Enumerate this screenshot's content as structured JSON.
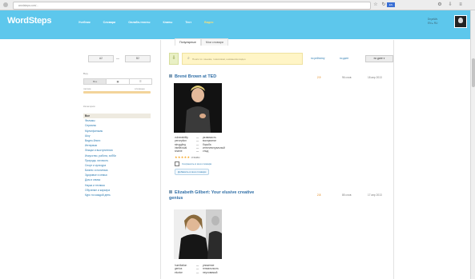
{
  "browser": {
    "url": "wordsteps.com/...",
    "badge": "EN"
  },
  "site": {
    "logo": "WordSteps",
    "nav": [
      "Учебник",
      "Словари",
      "Онлайн-тексты",
      "Клипы",
      "Тест",
      "Видео"
    ],
    "user_line1": "DnyaWs",
    "user_line2": "EN ▸ RU"
  },
  "tabs": [
    "Популярные",
    "Мои словари"
  ],
  "sidebar": {
    "level_from": "A2",
    "level_to": "B2",
    "level_dash": "—",
    "view_label": "Вид",
    "view_options": [
      "Все",
      "▦",
      "☰"
    ],
    "range_min": "легкие",
    "range_max": "сложные",
    "categories_label": "Категории",
    "categories": [
      "Все",
      "Фильмы",
      "Сериалы",
      "Мультфильмы",
      "Шоу",
      "Видео-блоги",
      "Интервью",
      "Лекции и выступления",
      "Искусство, работа, хобби",
      "Природа, личность",
      "Спорт и культура",
      "Бизнес и политика",
      "Здоровье и семья",
      "Дом и семья",
      "Наука и техника",
      "Обучение и карьера",
      "Курс по каждой день"
    ]
  },
  "search": {
    "placeholder": "Поиск по: языкам, тематикам, названиям видео",
    "sort_popularity": "по рейтингу",
    "sort_date": "по дате",
    "sort_button": "по дате ▾"
  },
  "videos": [
    {
      "title": "Brené Brown at TED",
      "level": "2.9",
      "words": "96 слов",
      "date": "18 апр 2013",
      "vocab": [
        [
          "vulnerability",
          "уязвимость"
        ],
        [
          "perception",
          "восприятие"
        ],
        [
          "struggling",
          "борьба"
        ],
        [
          "intellectual",
          "интеллектуальный"
        ],
        [
          "shame",
          "стыд"
        ]
      ],
      "rating_label": "★★★★★",
      "rating_count": "отзывы",
      "save_label": "Сохранить в мои словари",
      "add_label": "Добавить в мои словари"
    },
    {
      "title": "Elizabeth Gilbert: Your elusive creative genius",
      "level": "2.8",
      "words": "85 слов",
      "date": "17 апр 2013",
      "vocab": [
        [
          "humiliation",
          "унижение"
        ],
        [
          "genius",
          "гениальность"
        ],
        [
          "elusive",
          "неуловимый"
        ]
      ]
    }
  ],
  "colors": {
    "header": "#5dc7ec",
    "link": "#2a7ab0",
    "search_bg": "#fff5c6",
    "range": "#f3d49a"
  }
}
